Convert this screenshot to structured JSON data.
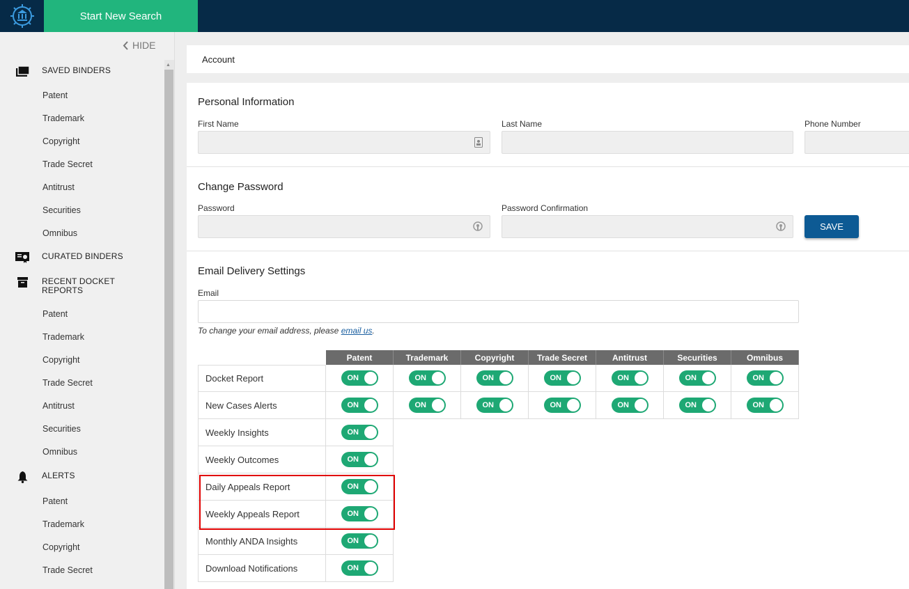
{
  "header": {
    "logo_icon": "courthouse-logo-icon",
    "start_button": "Start New Search",
    "colors": {
      "bar": "#062a47",
      "accent": "#21b57d"
    }
  },
  "sidebar": {
    "hide_label": "HIDE",
    "saved_binders": {
      "title": "SAVED BINDERS",
      "icon": "folder-icon",
      "items": [
        "Patent",
        "Trademark",
        "Copyright",
        "Trade Secret",
        "Antitrust",
        "Securities",
        "Omnibus"
      ]
    },
    "curated_binders": {
      "title": "CURATED BINDERS",
      "icon": "certificate-icon"
    },
    "recent_docket": {
      "title": "RECENT DOCKET REPORTS",
      "icon": "archive-box-icon",
      "items": [
        "Patent",
        "Trademark",
        "Copyright",
        "Trade Secret",
        "Antitrust",
        "Securities",
        "Omnibus"
      ]
    },
    "alerts": {
      "title": "ALERTS",
      "icon": "bell-icon",
      "items": [
        "Patent",
        "Trademark",
        "Copyright",
        "Trade Secret"
      ]
    }
  },
  "breadcrumb": "Account",
  "personal": {
    "title": "Personal Information",
    "first_name_label": "First Name",
    "last_name_label": "Last Name",
    "phone_label": "Phone Number"
  },
  "password": {
    "title": "Change Password",
    "password_label": "Password",
    "confirm_label": "Password Confirmation",
    "save_label": "SAVE"
  },
  "email": {
    "title": "Email Delivery Settings",
    "email_label": "Email",
    "note_prefix": "To change your email address, please ",
    "note_link": "email us",
    "note_suffix": "."
  },
  "delivery": {
    "columns": [
      "Patent",
      "Trademark",
      "Copyright",
      "Trade Secret",
      "Antitrust",
      "Securities",
      "Omnibus"
    ],
    "toggle_label": "ON",
    "toggle_color": "#1ea874",
    "rows": [
      {
        "label": "Docket Report",
        "toggles": 7
      },
      {
        "label": "New Cases Alerts",
        "toggles": 7
      },
      {
        "label": "Weekly Insights",
        "toggles": 1
      },
      {
        "label": "Weekly Outcomes",
        "toggles": 1
      },
      {
        "label": "Daily Appeals Report",
        "toggles": 1
      },
      {
        "label": "Weekly Appeals Report",
        "toggles": 1
      },
      {
        "label": "Monthly ANDA Insights",
        "toggles": 1
      },
      {
        "label": "Download Notifications",
        "toggles": 1
      }
    ],
    "highlight_color": "#e00000"
  }
}
